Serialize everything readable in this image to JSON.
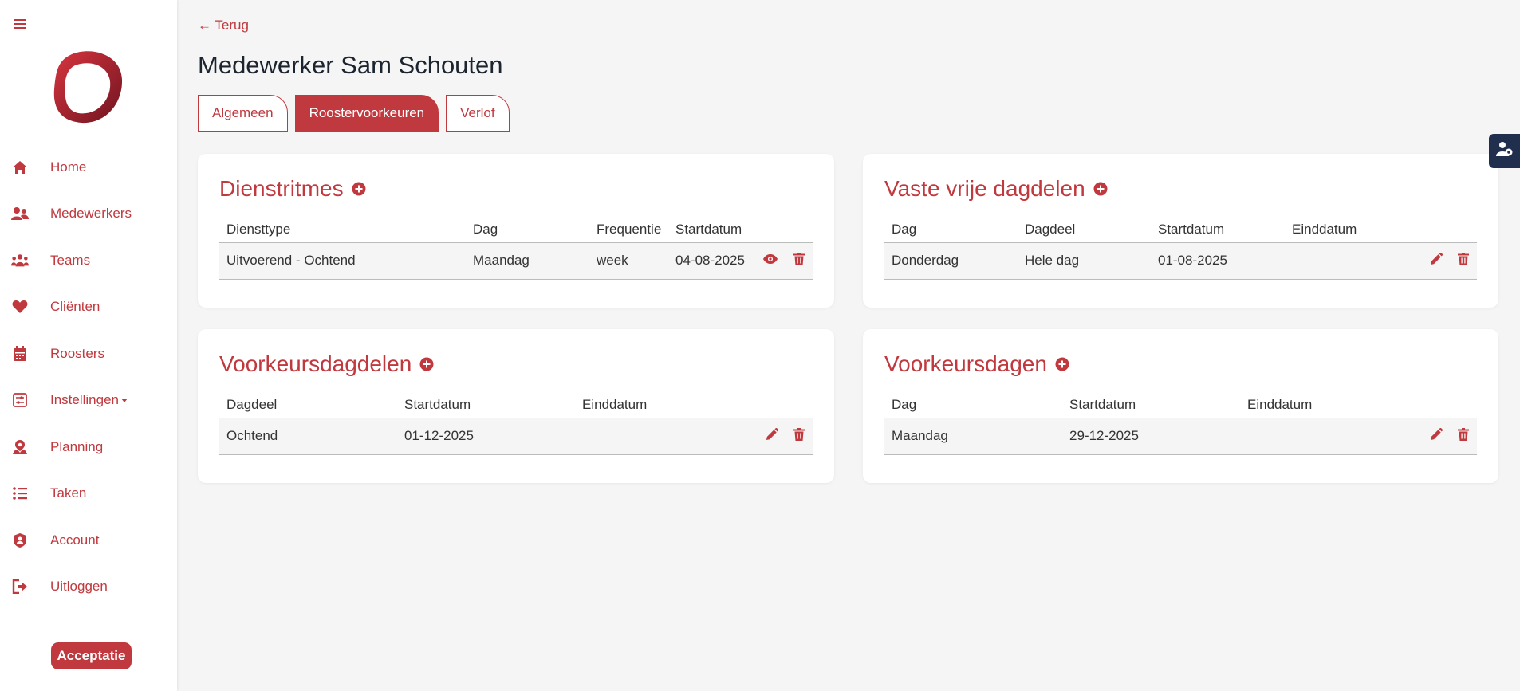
{
  "sidebar": {
    "items": [
      {
        "label": "Home",
        "icon": "home-icon"
      },
      {
        "label": "Medewerkers",
        "icon": "users-icon"
      },
      {
        "label": "Teams",
        "icon": "team-icon"
      },
      {
        "label": "Cliënten",
        "icon": "heart-icon"
      },
      {
        "label": "Roosters",
        "icon": "calendar-icon"
      },
      {
        "label": "Instellingen",
        "icon": "sliders-icon"
      },
      {
        "label": "Planning",
        "icon": "map-pin-icon"
      },
      {
        "label": "Taken",
        "icon": "list-icon"
      },
      {
        "label": "Account",
        "icon": "user-shield-icon"
      },
      {
        "label": "Uitloggen",
        "icon": "logout-icon"
      }
    ],
    "environment_badge": "Acceptatie"
  },
  "header": {
    "back_label": "← Terug",
    "title": "Medewerker Sam Schouten"
  },
  "tabs": [
    {
      "label": "Algemeen",
      "active": false
    },
    {
      "label": "Roostervoorkeuren",
      "active": true
    },
    {
      "label": "Verlof",
      "active": false
    }
  ],
  "cards": {
    "dienstritmes": {
      "title": "Dienstritmes",
      "columns": [
        "Diensttype",
        "Dag",
        "Frequentie",
        "Startdatum"
      ],
      "rows": [
        [
          "Uitvoerend - Ochtend",
          "Maandag",
          "week",
          "04-08-2025"
        ]
      ]
    },
    "vaste_vrije_dagdelen": {
      "title": "Vaste vrije dagdelen",
      "columns": [
        "Dag",
        "Dagdeel",
        "Startdatum",
        "Einddatum"
      ],
      "rows": [
        [
          "Donderdag",
          "Hele dag",
          "01-08-2025",
          ""
        ]
      ]
    },
    "voorkeursdagdelen": {
      "title": "Voorkeursdagdelen",
      "columns": [
        "Dagdeel",
        "Startdatum",
        "Einddatum"
      ],
      "rows": [
        [
          "Ochtend",
          "01-12-2025",
          ""
        ]
      ]
    },
    "voorkeursdagen": {
      "title": "Voorkeursdagen",
      "columns": [
        "Dag",
        "Startdatum",
        "Einddatum"
      ],
      "rows": [
        [
          "Maandag",
          "29-12-2025",
          ""
        ]
      ]
    }
  },
  "colors": {
    "accent": "#c0393e",
    "sidebar_bg": "#ffffff",
    "page_bg": "#f5f5f5",
    "float_button": "#1f2f4d"
  }
}
